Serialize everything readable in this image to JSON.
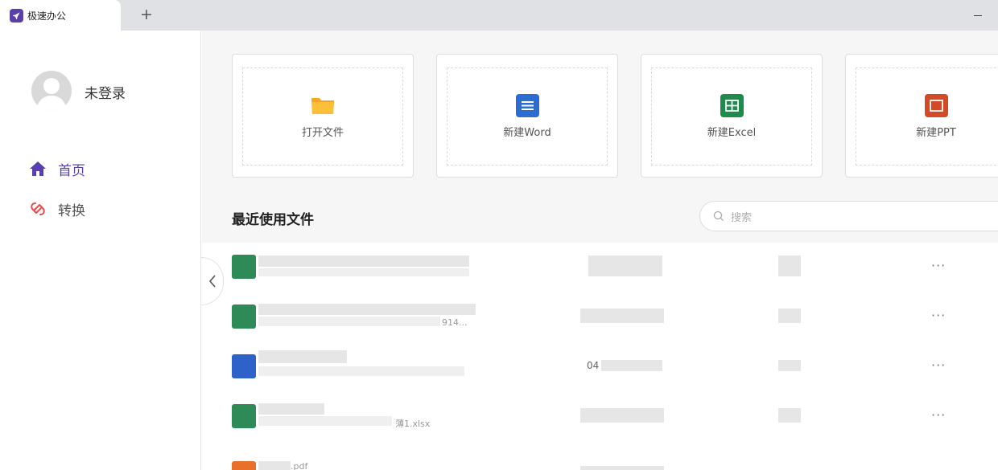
{
  "tabbar": {
    "tab_title": "极速办公",
    "new_tab_label": "+",
    "minimize_label": "—"
  },
  "sidebar": {
    "username": "未登录",
    "nav": [
      {
        "label": "首页",
        "icon": "home-icon",
        "active": true
      },
      {
        "label": "转换",
        "icon": "convert-icon",
        "active": false
      }
    ],
    "collapse_label": "‹"
  },
  "actions": [
    {
      "label": "打开文件",
      "icon": "folder-icon",
      "color": "#f5a623"
    },
    {
      "label": "新建Word",
      "icon": "word-icon",
      "color": "#2b6dd3"
    },
    {
      "label": "新建Excel",
      "icon": "excel-icon",
      "color": "#1e8a4c"
    },
    {
      "label": "新建PPT",
      "icon": "ppt-icon",
      "color": "#d24b26"
    }
  ],
  "recent": {
    "title": "最近使用文件",
    "search_placeholder": "搜索",
    "rows": [
      {
        "type": "excel",
        "name_fragment": "",
        "more": "···"
      },
      {
        "type": "excel",
        "name_fragment": "914...",
        "more": "···"
      },
      {
        "type": "word",
        "name_fragment": "",
        "size_fragment": "04",
        "more": "···"
      },
      {
        "type": "excel",
        "name_fragment": "薄1.xlsx",
        "more": "···"
      },
      {
        "type": "pdf",
        "name_fragment": ".pdf",
        "more": "···"
      }
    ]
  },
  "colors": {
    "accent": "#5a3fb0",
    "convert": "#e84b4b",
    "excel": "#2e8b57",
    "word": "#2f62c8",
    "pdf": "#e8702a"
  }
}
